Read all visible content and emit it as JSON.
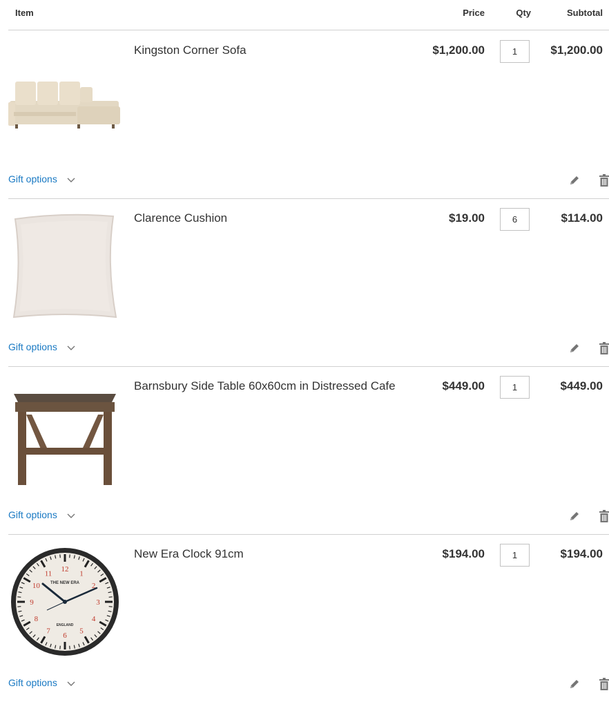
{
  "header": {
    "item": "Item",
    "price": "Price",
    "qty": "Qty",
    "subtotal": "Subtotal"
  },
  "items": [
    {
      "name": "Kingston Corner Sofa",
      "price": "$1,200.00",
      "qty": "1",
      "subtotal": "$1,200.00",
      "gift": "Gift options",
      "image": "sofa"
    },
    {
      "name": "Clarence Cushion",
      "price": "$19.00",
      "qty": "6",
      "subtotal": "$114.00",
      "gift": "Gift options",
      "image": "cushion"
    },
    {
      "name": "Barnsbury Side Table 60x60cm in Distressed Cafe",
      "price": "$449.00",
      "qty": "1",
      "subtotal": "$449.00",
      "gift": "Gift options",
      "image": "side-table"
    },
    {
      "name": "New Era Clock 91cm",
      "price": "$194.00",
      "qty": "1",
      "subtotal": "$194.00",
      "gift": "Gift options",
      "image": "clock"
    }
  ],
  "clock_face": {
    "top": "THE NEW ERA",
    "bottom": "ENGLAND",
    "numerals": [
      "12",
      "1",
      "2",
      "3",
      "4",
      "5",
      "6",
      "7",
      "8",
      "9",
      "10",
      "11"
    ]
  },
  "colors": {
    "link": "#1979c3",
    "border": "#d1d1d1",
    "text": "#333333",
    "icon": "#757575"
  }
}
